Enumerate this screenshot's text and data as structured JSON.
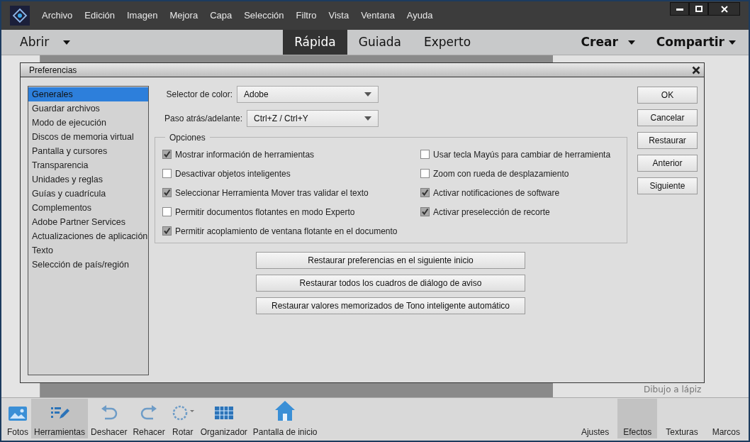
{
  "menu_bar": {
    "items": [
      "Archivo",
      "Edición",
      "Imagen",
      "Mejora",
      "Capa",
      "Selección",
      "Filtro",
      "Vista",
      "Ventana",
      "Ayuda"
    ]
  },
  "mode_bar": {
    "open": "Abrir",
    "modes": [
      {
        "label": "Rápida",
        "selected": true
      },
      {
        "label": "Guiada",
        "selected": false
      },
      {
        "label": "Experto",
        "selected": false
      }
    ],
    "create": "Crear",
    "share": "Compartir"
  },
  "background_panel": {
    "item_label": "Dibujo a lápiz"
  },
  "dialog": {
    "title": "Preferencias",
    "categories": [
      {
        "label": "Generales",
        "selected": true
      },
      {
        "label": "Guardar archivos",
        "selected": false
      },
      {
        "label": "Modo de ejecución",
        "selected": false
      },
      {
        "label": "Discos de memoria virtual",
        "selected": false
      },
      {
        "label": "Pantalla y cursores",
        "selected": false
      },
      {
        "label": "Transparencia",
        "selected": false
      },
      {
        "label": "Unidades y reglas",
        "selected": false
      },
      {
        "label": "Guías y cuadrícula",
        "selected": false
      },
      {
        "label": "Complementos",
        "selected": false
      },
      {
        "label": "Adobe Partner Services",
        "selected": false
      },
      {
        "label": "Actualizaciones de aplicación",
        "selected": false
      },
      {
        "label": "Texto",
        "selected": false
      },
      {
        "label": "Selección de país/región",
        "selected": false
      }
    ],
    "fields": [
      {
        "label": "Selector de color:",
        "value": "Adobe"
      },
      {
        "label": "Paso atrás/adelante:",
        "value": "Ctrl+Z / Ctrl+Y"
      }
    ],
    "options": {
      "title": "Opciones",
      "left": [
        {
          "label": "Mostrar información de herramientas",
          "checked": true
        },
        {
          "label": "Desactivar objetos inteligentes",
          "checked": false
        },
        {
          "label": "Seleccionar Herramienta Mover tras validar el texto",
          "checked": true
        },
        {
          "label": "Permitir documentos flotantes en modo Experto",
          "checked": false
        },
        {
          "label": "Permitir acoplamiento de ventana flotante en el documento",
          "checked": true
        }
      ],
      "right": [
        {
          "label": "Usar tecla Mayús para cambiar de herramienta",
          "checked": false
        },
        {
          "label": "Zoom con rueda de desplazamiento",
          "checked": false
        },
        {
          "label": "Activar notificaciones de software",
          "checked": true
        },
        {
          "label": "Activar preselección de recorte",
          "checked": true
        }
      ]
    },
    "reset_buttons": [
      "Restaurar preferencias en el siguiente inicio",
      "Restaurar todos los cuadros de diálogo de aviso",
      "Restaurar valores memorizados de Tono inteligente automático"
    ],
    "side_buttons": [
      "OK",
      "Cancelar",
      "Restaurar",
      "Anterior",
      "Siguiente"
    ]
  },
  "bottom_bar": {
    "left": [
      {
        "kind": "photos",
        "label": "Fotos",
        "selected": false
      },
      {
        "kind": "tools",
        "label": "Herramientas",
        "selected": true
      },
      {
        "kind": "undo",
        "label": "Deshacer",
        "selected": false
      },
      {
        "kind": "redo",
        "label": "Rehacer",
        "selected": false
      },
      {
        "kind": "rotate",
        "label": "Rotar",
        "selected": false
      },
      {
        "kind": "organizer",
        "label": "Organizador",
        "selected": false
      },
      {
        "kind": "home",
        "label": "Pantalla de inicio",
        "selected": false
      }
    ],
    "right": [
      {
        "label": "Ajustes",
        "selected": false
      },
      {
        "label": "Efectos",
        "selected": true
      },
      {
        "label": "Texturas",
        "selected": false
      },
      {
        "label": "Marcos",
        "selected": false
      }
    ]
  }
}
